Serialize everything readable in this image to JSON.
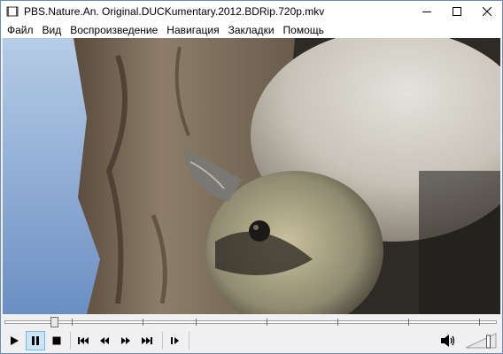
{
  "window": {
    "title": "PBS.Nature.An. Original.DUCKumentary.2012.BDRip.720p.mkv"
  },
  "menu": {
    "items": [
      "Файл",
      "Вид",
      "Воспроизведение",
      "Навигация",
      "Закладки",
      "Помощь"
    ]
  },
  "player": {
    "seek_position": 0.1,
    "volume": 0.75,
    "paused": true
  },
  "icons": {
    "app": "media-player-icon",
    "minimize": "minimize-icon",
    "maximize": "maximize-icon",
    "close": "close-icon",
    "play": "play-icon",
    "pause": "pause-icon",
    "stop": "stop-icon",
    "prev": "skip-back-icon",
    "rewind": "rewind-icon",
    "forward": "fast-forward-icon",
    "next": "skip-forward-icon",
    "frame_step": "frame-step-icon",
    "volume": "speaker-icon"
  },
  "colors": {
    "active_button": "#cce4f7",
    "window_border": "#6e8bb4"
  }
}
